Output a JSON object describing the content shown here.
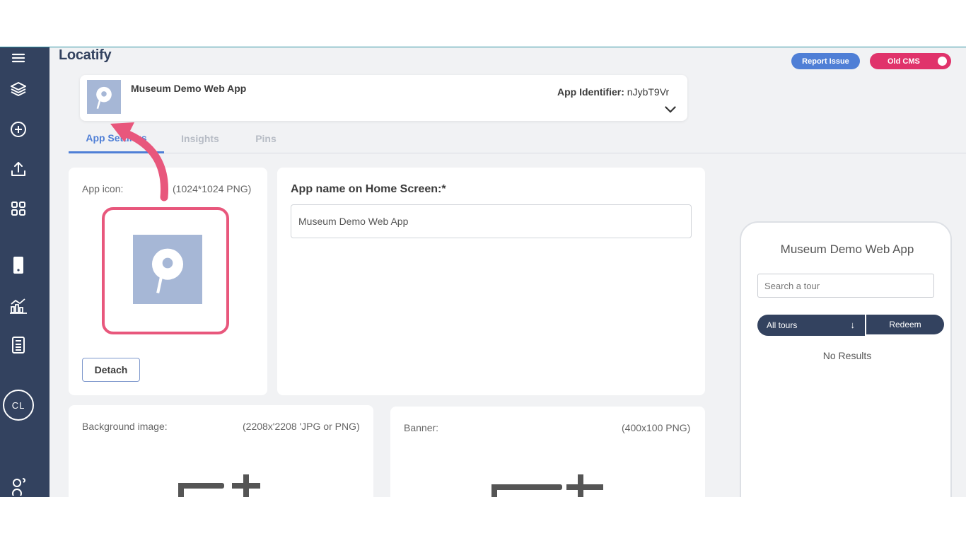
{
  "brand": {
    "logo": "Locatify"
  },
  "header": {
    "report_issue": "Report Issue",
    "old_cms": "Old CMS"
  },
  "app_card": {
    "name": "Museum Demo Web App",
    "identifier_label": "App Identifier:",
    "identifier_value": "nJybT9Vr"
  },
  "tabs": [
    {
      "label": "App Settings",
      "active": true
    },
    {
      "label": "Insights",
      "active": false
    },
    {
      "label": "Pins",
      "active": false
    }
  ],
  "icon_panel": {
    "label": "App icon:",
    "spec": "(1024*1024 PNG)",
    "detach": "Detach"
  },
  "name_panel": {
    "title": "App name on Home Screen:*",
    "value": "Museum Demo Web App"
  },
  "background_panel": {
    "label": "Background image:",
    "spec": "(2208x'2208 'JPG or PNG)"
  },
  "banner_panel": {
    "label": "Banner:",
    "spec": "(400x100 PNG)"
  },
  "preview": {
    "title": "Museum Demo Web App",
    "search_placeholder": "Search a tour",
    "all_tours": "All tours",
    "redeem": "Redeem",
    "no_results": "No Results"
  },
  "sidebar": {
    "user_initials": "CL",
    "icons": [
      "menu-icon",
      "layers-icon",
      "add-circle-icon",
      "upload-icon",
      "apps-grid-icon",
      "phone-icon",
      "analytics-icon",
      "calculator-icon",
      "user-avatar",
      "help-user-icon"
    ]
  },
  "colors": {
    "sidebar": "#33425f",
    "accent": "#4f7fd6",
    "danger": "#e0336b",
    "highlight": "#e8577c"
  }
}
